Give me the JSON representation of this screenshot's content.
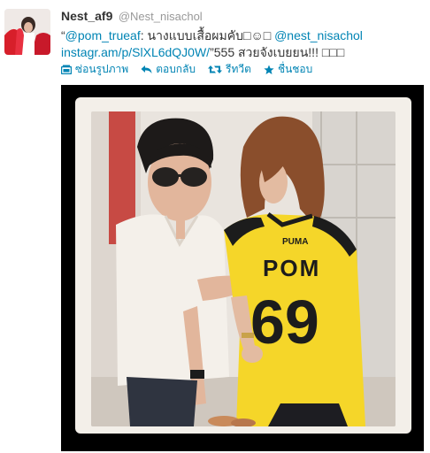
{
  "user": {
    "display_name": "Nest_af9",
    "screen_name": "@Nest_nisachol",
    "avatar_icon": "profile-photo"
  },
  "tweet": {
    "quote_open": "“",
    "mention_1": "@pom_trueaf",
    "text_1": ": นางแบบเสื้อผมคับ□☺□ ",
    "mention_2": "@nest_nisachol",
    "link": "instagr.am/p/SlXL6dQJ0W/",
    "text_2": "”555 สวยจังเบยยน!!! □□□"
  },
  "actions": {
    "hide_photo": "ซ่อนรูปภาพ",
    "reply": "ตอบกลับ",
    "retweet": "รีทวีต",
    "favorite": "ชื่นชอบ"
  },
  "photo": {
    "jersey_name": "POM",
    "jersey_number": "69",
    "jersey_brand": "PUMA"
  },
  "colors": {
    "link": "#0084b4",
    "text": "#333333",
    "muted": "#999999",
    "jersey": "#f5d629"
  }
}
